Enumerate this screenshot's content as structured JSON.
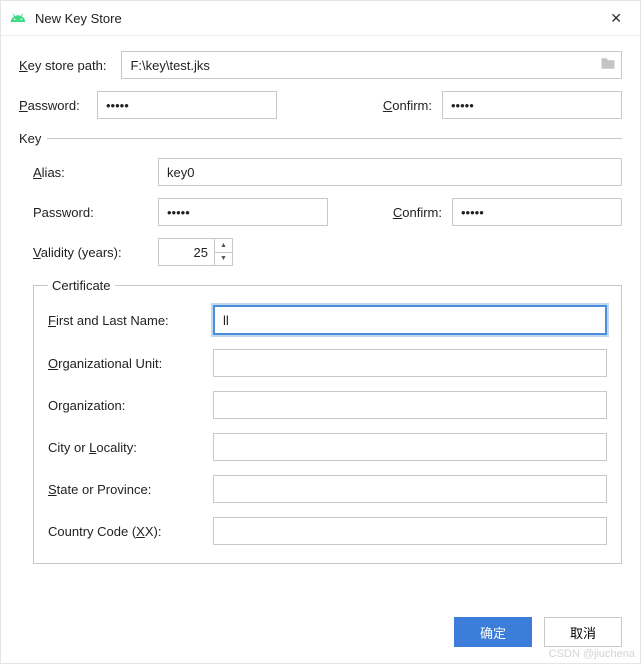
{
  "window": {
    "title": "New Key Store"
  },
  "keystore": {
    "path_label_pre": "K",
    "path_label_post": "ey store path:",
    "path_value": "F:\\key\\test.jks",
    "password_label_pre": "P",
    "password_label_post": "assword:",
    "password_value": "•••••",
    "confirm_label_pre": "C",
    "confirm_label_post": "onfirm:",
    "confirm_value": "•••••"
  },
  "key": {
    "legend": "Key",
    "alias_label_pre": "A",
    "alias_label_post": "lias:",
    "alias_value": "key0",
    "password_label": "Password:",
    "password_value": "•••••",
    "confirm_label_pre": "C",
    "confirm_label_post": "onfirm:",
    "confirm_value": "•••••",
    "validity_label_pre": "V",
    "validity_label_post": "alidity (years):",
    "validity_value": "25"
  },
  "cert": {
    "legend": "Certificate",
    "first_last_label_pre": "F",
    "first_last_label_post": "irst and Last Name:",
    "first_last_value": "ll",
    "org_unit_label_pre": "O",
    "org_unit_label_post": "rganizational Unit:",
    "org_unit_value": "",
    "org_label": "Organization:",
    "org_value": "",
    "city_label_pre": "City or ",
    "city_label_mn": "L",
    "city_label_post": "ocality:",
    "city_value": "",
    "state_label_pre": "S",
    "state_label_post": "tate or Province:",
    "state_value": "",
    "country_label_pre": "Country Code (",
    "country_label_mn": "X",
    "country_label_post": "X):",
    "country_value": ""
  },
  "footer": {
    "ok": "确定",
    "cancel": "取消"
  },
  "watermark": "CSDN @jiuchena"
}
